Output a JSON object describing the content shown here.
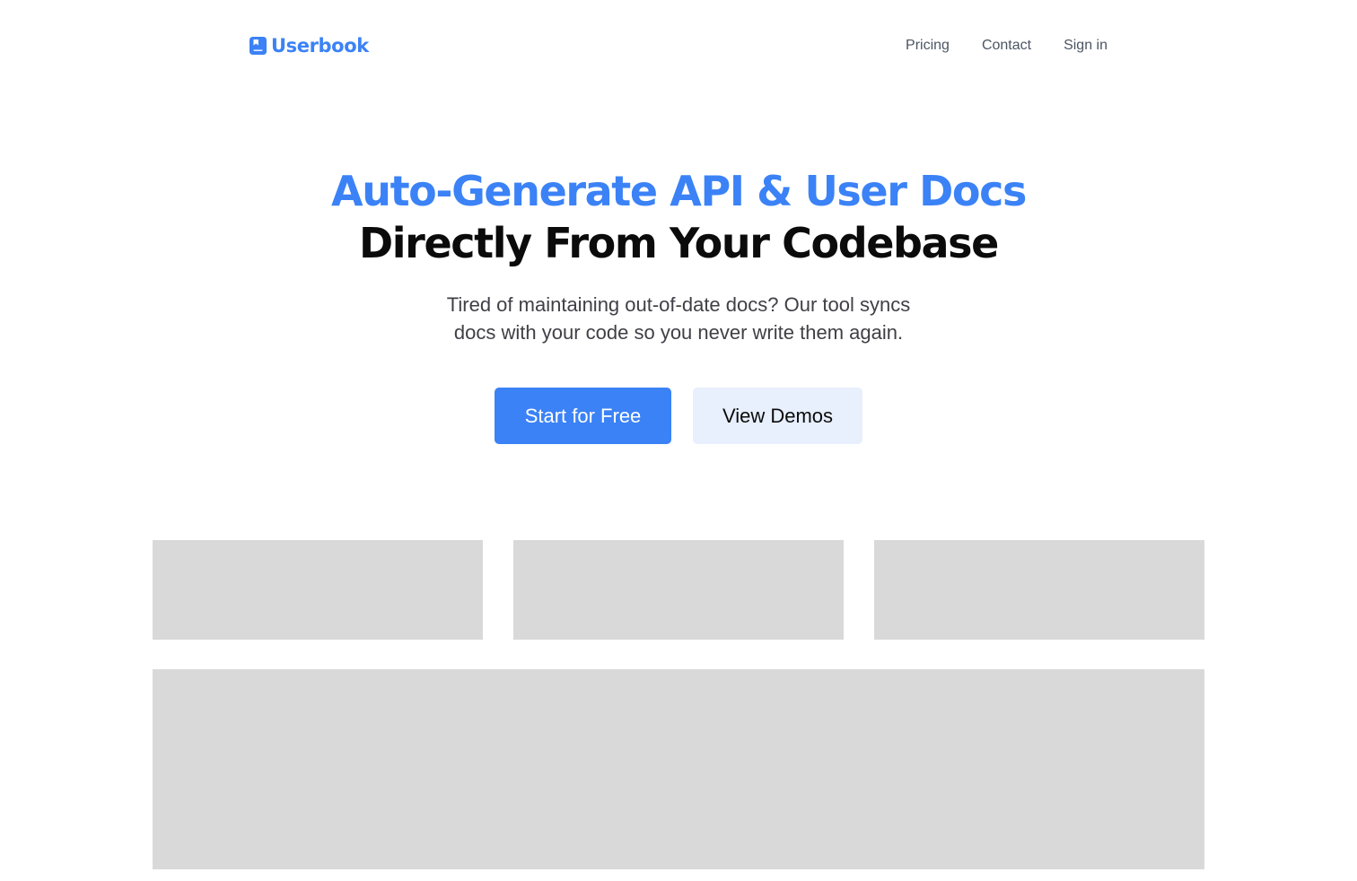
{
  "header": {
    "brand_name": "Userbook",
    "nav": [
      {
        "label": "Pricing"
      },
      {
        "label": "Contact"
      },
      {
        "label": "Sign in"
      }
    ]
  },
  "hero": {
    "headline_line1": "Auto-Generate API & User Docs",
    "headline_line2": "Directly From Your Codebase",
    "subtitle_line1": "Tired of maintaining out-of-date docs? Our tool syncs",
    "subtitle_line2": "docs with your code so you never write them again."
  },
  "cta": {
    "primary_label": "Start for Free",
    "secondary_label": "View Demos"
  },
  "icons": {
    "brand": "book-icon"
  },
  "colors": {
    "accent": "#3b82f6",
    "secondary_button_bg": "#e8effd",
    "placeholder": "#d9d9d9",
    "heading_dark": "#0b0b0b",
    "nav_text": "#4b5563"
  }
}
